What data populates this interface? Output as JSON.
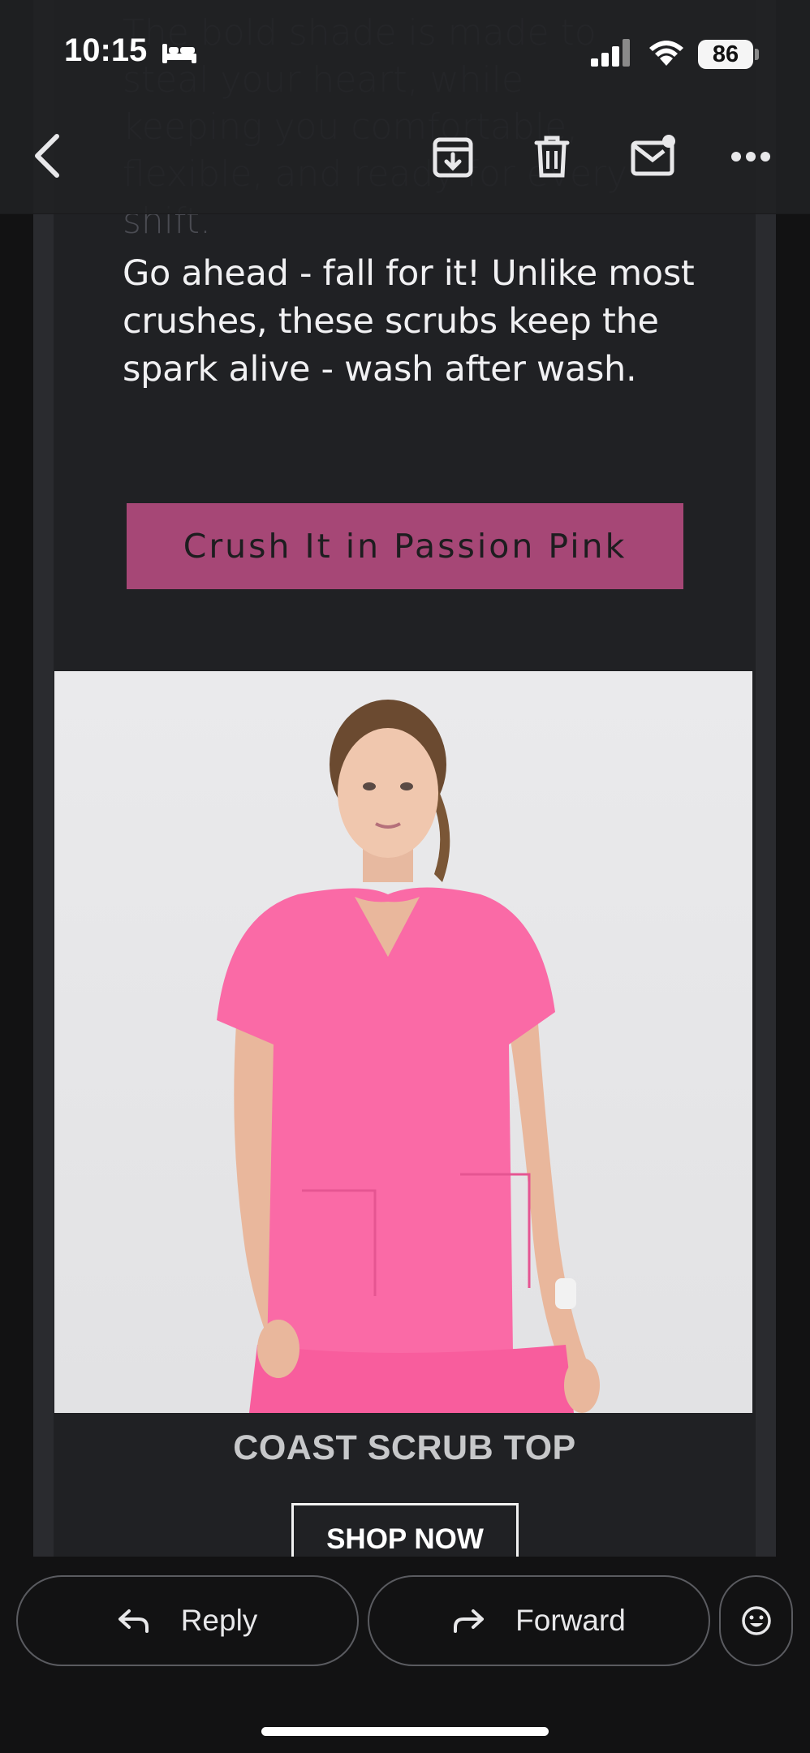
{
  "status_bar": {
    "time": "10:15",
    "battery": "86"
  },
  "toolbar": {
    "icons": [
      "back-icon",
      "archive-icon",
      "delete-icon",
      "mark-unread-icon",
      "more-icon"
    ]
  },
  "email": {
    "faded_paragraph": "The bold shade is made to steal your heart, while keeping you comfortable, flexible, and ready for every shift.",
    "body_paragraph": "Go ahead - fall for it! Unlike most crushes, these scrubs keep the spark alive - wash after wash.",
    "promo_button": "Crush It in Passion Pink",
    "product_title": "COAST SCRUB TOP",
    "shop_button": "SHOP NOW"
  },
  "actions": {
    "reply": "Reply",
    "forward": "Forward"
  },
  "colors": {
    "promo_button_bg": "#a64776",
    "scrub_pink": "#fa6aa6"
  }
}
